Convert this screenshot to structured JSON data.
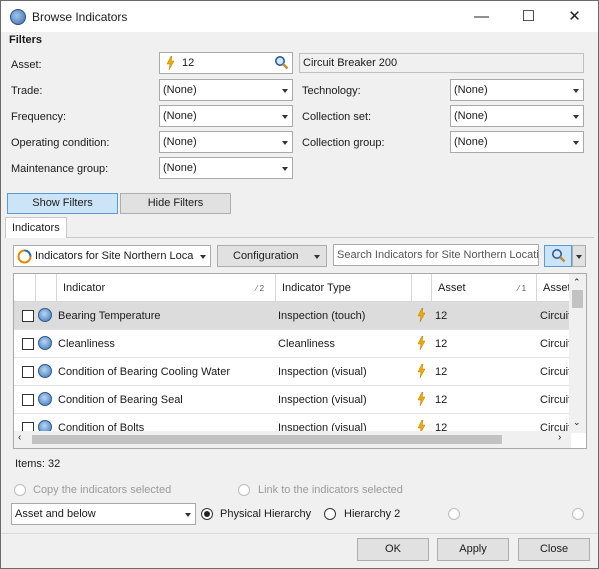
{
  "window": {
    "title": "Browse Indicators"
  },
  "filters": {
    "heading": "Filters",
    "asset_label": "Asset:",
    "asset_value": "12",
    "asset_name": "Circuit Breaker 200",
    "trade_label": "Trade:",
    "trade_value": "(None)",
    "technology_label": "Technology:",
    "technology_value": "(None)",
    "frequency_label": "Frequency:",
    "frequency_value": "(None)",
    "collection_set_label": "Collection set:",
    "collection_set_value": "(None)",
    "operating_condition_label": "Operating condition:",
    "operating_condition_value": "(None)",
    "collection_group_label": "Collection group:",
    "collection_group_value": "(None)",
    "maintenance_group_label": "Maintenance group:",
    "maintenance_group_value": "(None)",
    "show_filters": "Show Filters",
    "hide_filters": "Hide Filters"
  },
  "indicators": {
    "tab_label": "Indicators",
    "view_selector": "Indicators for Site Northern Loca",
    "configuration_label": "Configuration",
    "search_placeholder": "Search Indicators for Site Northern Locatio",
    "columns": {
      "indicator": "Indicator",
      "indicator_sort": "2",
      "indicator_type": "Indicator Type",
      "asset": "Asset",
      "asset_sort": "1",
      "asset_name": "Asset"
    },
    "rows": [
      {
        "indicator": "Bearing Temperature",
        "type": "Inspection (touch)",
        "asset": "12",
        "asset_name": "Circuit"
      },
      {
        "indicator": "Cleanliness",
        "type": "Cleanliness",
        "asset": "12",
        "asset_name": "Circuit"
      },
      {
        "indicator": "Condition of Bearing Cooling Water",
        "type": "Inspection (visual)",
        "asset": "12",
        "asset_name": "Circuit"
      },
      {
        "indicator": "Condition of Bearing Seal",
        "type": "Inspection (visual)",
        "asset": "12",
        "asset_name": "Circuit"
      },
      {
        "indicator": "Condition of Bolts",
        "type": "Inspection (visual)",
        "asset": "12",
        "asset_name": "Circuit"
      }
    ],
    "items_count": "Items: 32"
  },
  "options": {
    "copy_label": "Copy the indicators selected",
    "link_label": "Link to the indicators selected",
    "scope_value": "Asset and below",
    "physical_hierarchy": "Physical Hierarchy",
    "hierarchy_2": "Hierarchy 2"
  },
  "footer": {
    "ok": "OK",
    "apply": "Apply",
    "close": "Close"
  },
  "colors": {
    "bolt": "#f2a900",
    "selection": "#cce4f7",
    "row_selected": "#dcdcdc"
  }
}
